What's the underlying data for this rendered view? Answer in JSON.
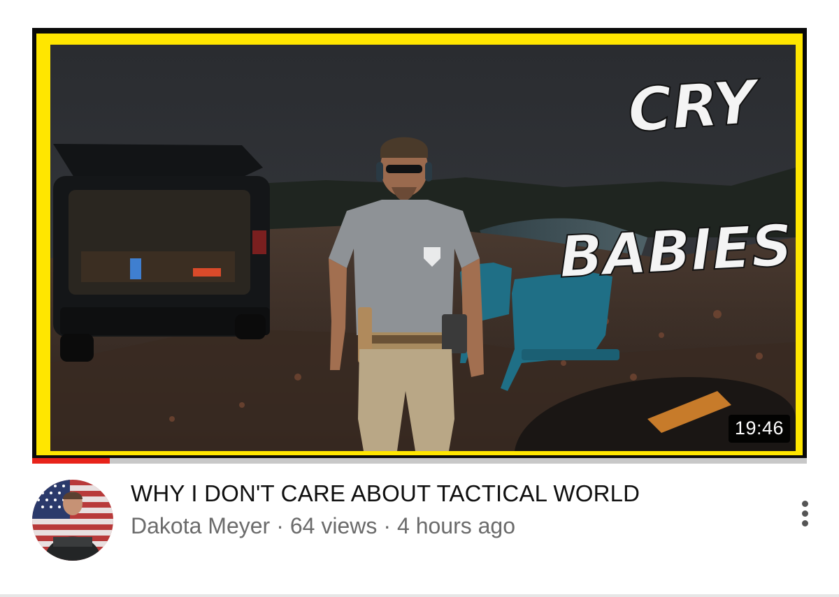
{
  "video": {
    "thumbnail": {
      "overlay_text_line1": "CRY",
      "overlay_text_line2": "BABIES",
      "frame_color": "#ffe600"
    },
    "duration": "19:46",
    "watch_progress": 0.1,
    "title": "WHY I DON'T CARE ABOUT TACTICAL WORLD",
    "channel": "Dakota Meyer",
    "separator": "·",
    "views": "64 views",
    "age": "4 hours ago",
    "menu_icon": "more-vert-icon"
  },
  "colors": {
    "progress": "#e8231a",
    "title": "#0f0f0f",
    "meta": "#6b6b6b"
  }
}
